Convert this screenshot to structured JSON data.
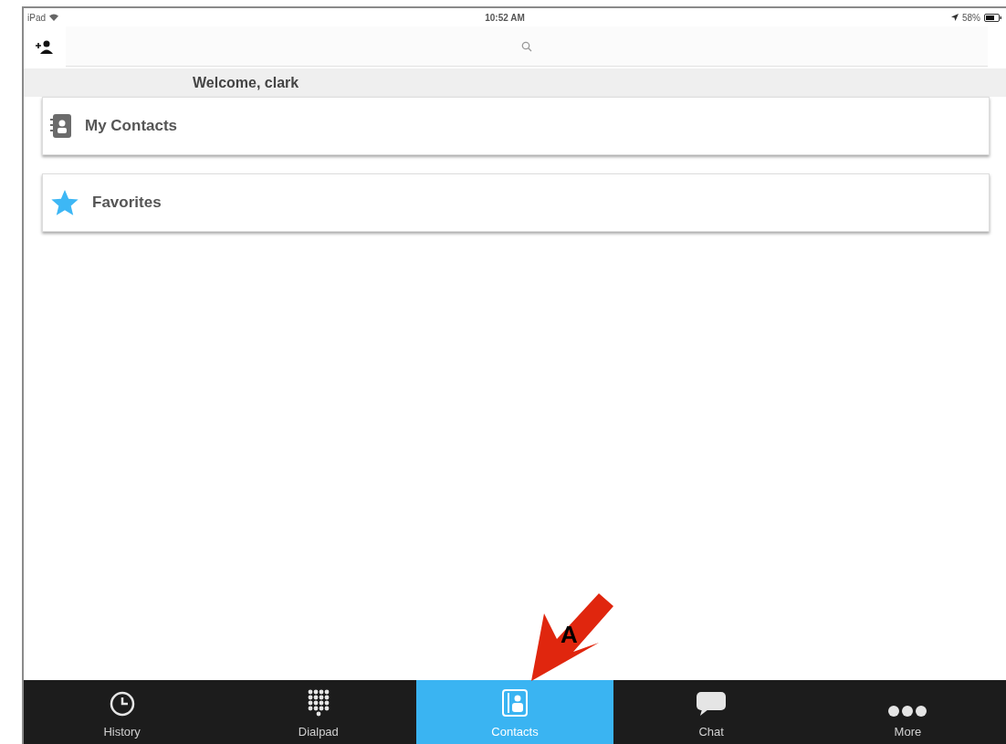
{
  "status_bar": {
    "device": "iPad",
    "time": "10:52 AM",
    "battery": "58%"
  },
  "welcome": "Welcome, clark",
  "items": [
    {
      "kind": "contacts",
      "label": "My Contacts"
    },
    {
      "kind": "favorites",
      "label": "Favorites"
    }
  ],
  "tabs": [
    {
      "kind": "history",
      "label": "History",
      "selected": false
    },
    {
      "kind": "dialpad",
      "label": "Dialpad",
      "selected": false
    },
    {
      "kind": "contacts",
      "label": "Contacts",
      "selected": true
    },
    {
      "kind": "chat",
      "label": "Chat",
      "selected": false
    },
    {
      "kind": "more",
      "label": "More",
      "selected": false
    }
  ],
  "callout": {
    "label": "A"
  }
}
